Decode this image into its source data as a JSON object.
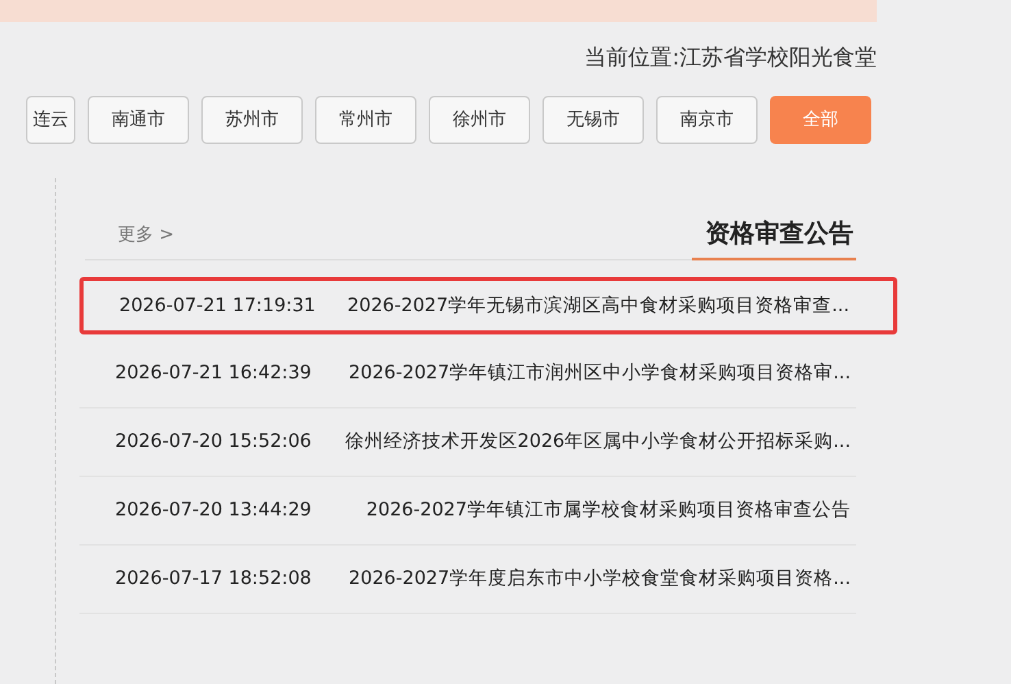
{
  "breadcrumb": "当前位置:江苏省学校阳光食堂",
  "city_tabs": [
    {
      "label": "连云",
      "selected": false
    },
    {
      "label": "南通市",
      "selected": false
    },
    {
      "label": "苏州市",
      "selected": false
    },
    {
      "label": "常州市",
      "selected": false
    },
    {
      "label": "徐州市",
      "selected": false
    },
    {
      "label": "无锡市",
      "selected": false
    },
    {
      "label": "南京市",
      "selected": false
    },
    {
      "label": "全部",
      "selected": true
    }
  ],
  "section": {
    "title": "资格审查公告",
    "more": "更多 >"
  },
  "notices": [
    {
      "title": "2026-2027学年无锡市滨湖区高中食材采购项目资格审查...",
      "time": "2026-07-21 17:19:31",
      "highlighted": true
    },
    {
      "title": "2026-2027学年镇江市润州区中小学食材采购项目资格审...",
      "time": "2026-07-21 16:42:39",
      "highlighted": false
    },
    {
      "title": "徐州经济技术开发区2026年区属中小学食材公开招标采购...",
      "time": "2026-07-20 15:52:06",
      "highlighted": false
    },
    {
      "title": "2026-2027学年镇江市属学校食材采购项目资格审查公告",
      "time": "2026-07-20 13:44:29",
      "highlighted": false
    },
    {
      "title": "2026-2027学年度启东市中小学校食堂食材采购项目资格...",
      "time": "2026-07-17 18:52:08",
      "highlighted": false
    }
  ]
}
